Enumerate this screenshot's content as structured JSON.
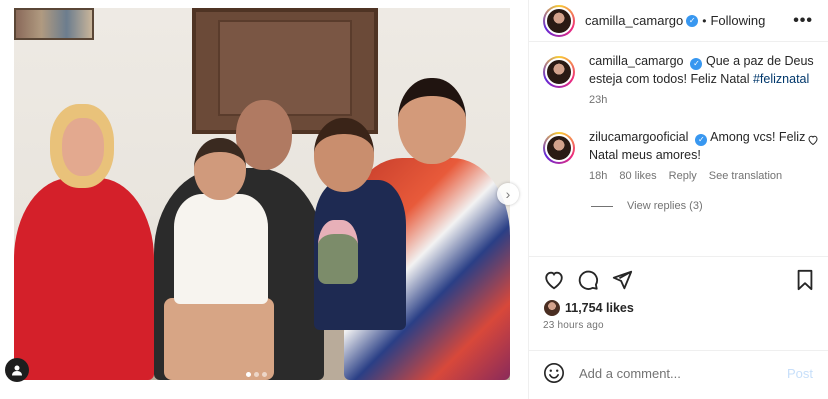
{
  "post": {
    "username": "camilla_camargo",
    "follow_status": "Following",
    "separator": "•",
    "more": "•••",
    "next": "›"
  },
  "caption": {
    "username": "camilla_camargo",
    "text": "Que a paz de Deus esteja com todos! Feliz Natal",
    "hashtag": "#feliznatal",
    "time": "23h"
  },
  "comment": {
    "username": "zilucamargooficial",
    "text": "Among vcs! Feliz Natal meus amores!",
    "time": "18h",
    "likes": "80 likes",
    "reply": "Reply",
    "translate": "See translation",
    "view_replies": "View replies (3)"
  },
  "engagement": {
    "likes": "11,754 likes",
    "time": "23 hours ago"
  },
  "composer": {
    "placeholder": "Add a comment...",
    "post_label": "Post"
  },
  "colors": {
    "verified": "#3897f0",
    "hashtag": "#00376b",
    "post_disabled": "#c7dffa"
  },
  "icons": [
    "verified-badge-icon",
    "heart-icon",
    "comment-icon",
    "share-icon",
    "bookmark-icon",
    "emoji-icon",
    "user-tag-icon",
    "chevron-right-icon"
  ]
}
